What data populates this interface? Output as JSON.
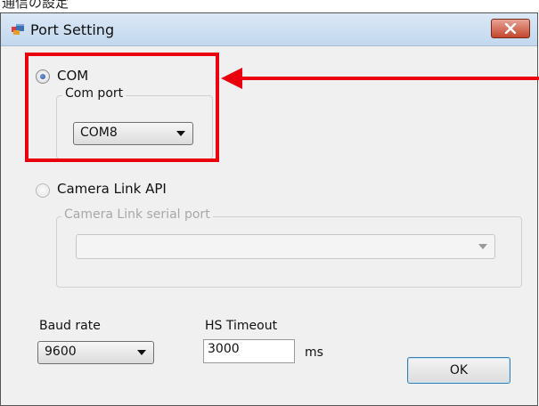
{
  "page_caption": "通信の設定",
  "window": {
    "title": "Port Setting"
  },
  "com_option": {
    "label": "COM",
    "selected": true
  },
  "com_port_group": {
    "title": "Com port",
    "selected_value": "COM8"
  },
  "camera_link_option": {
    "label": "Camera Link API",
    "selected": false
  },
  "camera_link_group": {
    "title": "Camera Link serial port",
    "selected_value": ""
  },
  "baud_rate": {
    "label": "Baud rate",
    "value": "9600"
  },
  "hs_timeout": {
    "label": "HS Timeout",
    "value": "3000",
    "unit": "ms"
  },
  "ok_button": {
    "label": "OK"
  },
  "annotation_color": "#e8000d",
  "icons": {
    "app": "app-window-icon",
    "close": "close-icon",
    "arrow": "dropdown-arrow-icon"
  }
}
